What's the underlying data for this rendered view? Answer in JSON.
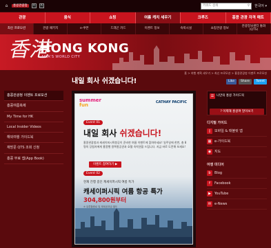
{
  "topbar": {
    "home_icon": "home-icon",
    "badge": "홍콩관광청",
    "font_size_a": "A",
    "font_size_b": "A",
    "search_placeholder": "키워드 검색",
    "search_icon": "magnifier-icon",
    "language": "한국어 ▾"
  },
  "nav_primary": [
    "관광",
    "음식",
    "쇼핑",
    "여름 캐치 세우기",
    "크루즈",
    "홍콩 관광 자격 매트"
  ],
  "nav_secondary": [
    "최신 프로모션",
    "관광 패키지",
    "e-쿠폰",
    "드래곤 카드",
    "이벤트 정보",
    "숙박시설",
    "쇼핑관광 정보",
    "관광정보센터 통화 (QTS)"
  ],
  "banner": {
    "calligraphy": "香港",
    "title": "HONG KONG",
    "subtitle": "ASIA'S WORLD CITY"
  },
  "breadcrumb": "홈 > 여행 계획 세우기 > 최신 프로모션 > 홍콩관광청 이벤트 프로모션",
  "page": {
    "title": "내일 회사 쉬겠습니다!",
    "share_fb": "Like",
    "share_print": "Share",
    "share_tw": "Tweet"
  },
  "sidebar": {
    "items": [
      "홍콩관광청 이벤트 프로모션",
      "홍콩여름축제",
      "My Time for HK",
      "Local Insider Videos",
      "해외여행 가이드북",
      "재방문 QTS 조회 신청",
      "홍콩 무료 앱(App Book)"
    ]
  },
  "promo": {
    "logo_a": "summer",
    "logo_b": "fun",
    "airline": "CATHAY PACIFIC",
    "event1_tag": "Event 01",
    "headline_a": "내일 회사 ",
    "headline_b": "쉬겠습니다!",
    "desc": "홍콩관광청과 캐세이퍼시픽항공이 준비한 여름 이벤트에 참여하세요! 일주일에 한번, 총 8명의 당첨자에게 홍콩행 왕복항공권과 호텔 숙박권을 드립니다. 지금 바로 도전해 보세요!",
    "btn1": "이벤트 참여하기 ▶",
    "event2_tag": "Event 02",
    "sub2": "현재 진행 중인 캐세이퍼시픽 여름 특가",
    "headline2": "캐세이퍼시픽 여름 항공 특가",
    "price": "304,800원부터",
    "price_note": "※ 유류할증료 및 제세공과금 별도",
    "btn2": "여름 특가 확인 하기 ▶"
  },
  "rightcol": {
    "guide_title": "나만의 홍콩 가이드북",
    "guide_button": "? 이제해 홍콩여 말이보기",
    "section1": "디지털 가이드",
    "links1": [
      {
        "icon": "mobile-icon",
        "label": "모바일 & 태블릿 앱"
      },
      {
        "icon": "ebook-icon",
        "label": "e-가이드북"
      },
      {
        "icon": "map-icon",
        "label": "지도"
      }
    ],
    "section2": "여행 미디어",
    "links2": [
      {
        "icon": "blog-icon",
        "label": "Blog"
      },
      {
        "icon": "facebook-icon",
        "label": "Facebook"
      },
      {
        "icon": "youtube-icon",
        "label": "YouTube"
      },
      {
        "icon": "enews-icon",
        "label": "e-News"
      }
    ]
  },
  "colors": {
    "accent": "#c8141e",
    "background": "#5a0a0d",
    "dark": "#1a0305"
  }
}
